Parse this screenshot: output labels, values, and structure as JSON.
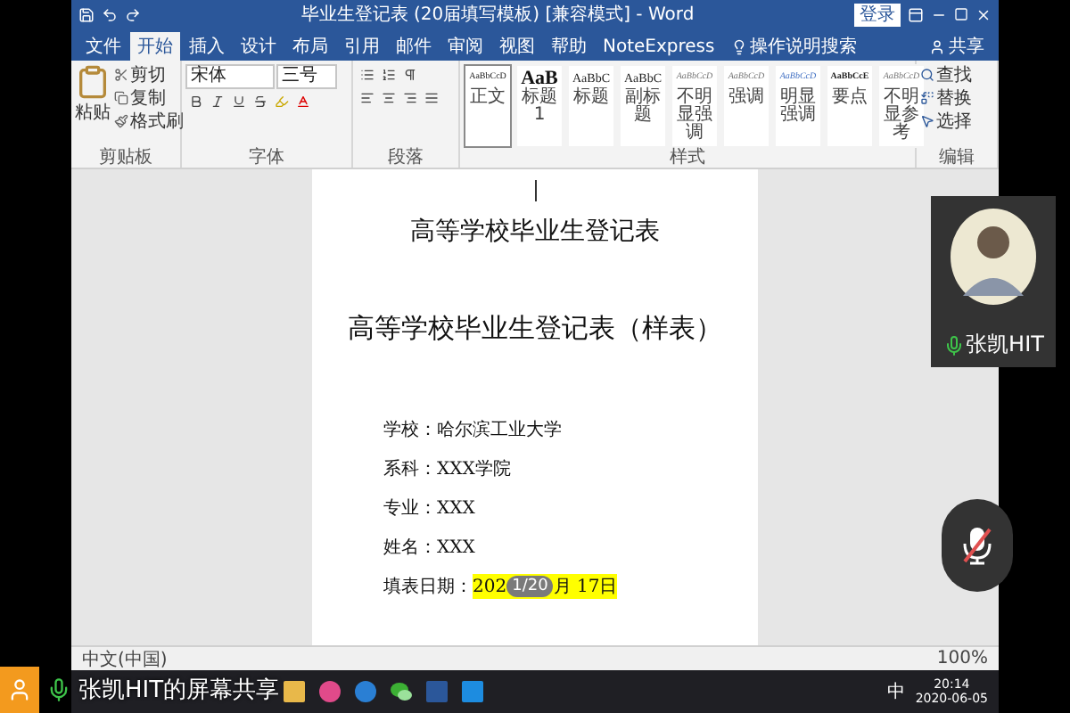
{
  "window": {
    "title": "毕业生登记表 (20届填写模板) [兼容模式] - Word",
    "sign_in": "登录"
  },
  "tabs": [
    {
      "label": "文件",
      "selected": false
    },
    {
      "label": "开始",
      "selected": true
    },
    {
      "label": "插入",
      "selected": false
    },
    {
      "label": "设计",
      "selected": false
    },
    {
      "label": "布局",
      "selected": false
    },
    {
      "label": "引用",
      "selected": false
    },
    {
      "label": "邮件",
      "selected": false
    },
    {
      "label": "审阅",
      "selected": false
    },
    {
      "label": "视图",
      "selected": false
    },
    {
      "label": "帮助",
      "selected": false
    },
    {
      "label": "NoteExpress",
      "selected": false
    }
  ],
  "tell_me": "操作说明搜索",
  "share": "共享",
  "clipboard": {
    "paste": "粘贴",
    "items": [
      "剪切",
      "复制",
      "格式刷"
    ],
    "label": "剪贴板"
  },
  "font": {
    "name": "宋体",
    "size": "三号",
    "label": "字体"
  },
  "paragraph": {
    "label": "段落"
  },
  "styles": {
    "label": "样式",
    "items": [
      {
        "sample": "AaBbCcD",
        "name": "正文",
        "kind": "body",
        "selected": true
      },
      {
        "sample": "AaB",
        "name": "标题 1",
        "kind": "heading",
        "selected": false
      },
      {
        "sample": "AaBbC",
        "name": "标题",
        "kind": "title",
        "selected": false
      },
      {
        "sample": "AaBbC",
        "name": "副标题",
        "kind": "title",
        "selected": false
      },
      {
        "sample": "AaBbCcD",
        "name": "不明显强调",
        "kind": "subtle",
        "selected": false
      },
      {
        "sample": "AaBbCcD",
        "name": "强调",
        "kind": "subtle",
        "selected": false
      },
      {
        "sample": "AaBbCcD",
        "name": "明显强调",
        "kind": "accent",
        "selected": false
      },
      {
        "sample": "AaBbCcE",
        "name": "要点",
        "kind": "strong",
        "selected": false
      },
      {
        "sample": "AaBbCcD",
        "name": "不明显参考",
        "kind": "subtle",
        "selected": false
      }
    ]
  },
  "editing": {
    "items": [
      "查找",
      "替换",
      "选择"
    ],
    "label": "编辑"
  },
  "document": {
    "heading": "高等学校毕业生登记表",
    "title": "高等学校毕业生登记表（样表）",
    "fields": [
      "学校：哈尔滨工业大学",
      "系科：XXX学院",
      "专业：XXX",
      "姓名：XXX"
    ],
    "date": {
      "label": "填表日期：",
      "value_before": "202",
      "value_after": "月 17日",
      "highlighted": true
    }
  },
  "page_badge": "1/20",
  "status_bar": {
    "language": "中文(中国)",
    "zoom": "100%"
  },
  "taskbar": {
    "ime": "中",
    "time": "20:14",
    "date": "2020-06-05"
  },
  "participant": {
    "name": "张凯HIT",
    "muted": false
  },
  "mute_button": {
    "muted": true
  },
  "share_label": "张凯HIT的屏幕共享"
}
